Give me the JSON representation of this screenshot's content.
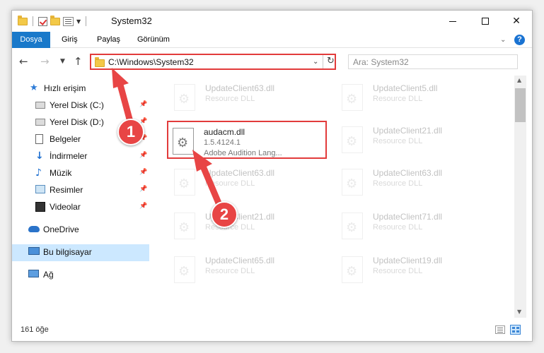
{
  "window": {
    "title": "System32"
  },
  "ribbon": {
    "tabs": [
      "Dosya",
      "Giriş",
      "Paylaş",
      "Görünüm"
    ],
    "help": "?"
  },
  "address": {
    "path": "C:\\Windows\\System32"
  },
  "search": {
    "placeholder": "Ara: System32"
  },
  "sidebar": {
    "items": [
      {
        "label": "Hızlı erişim",
        "icon": "star-icon"
      },
      {
        "label": "Yerel Disk (C:)",
        "icon": "disk-icon",
        "pinned": true
      },
      {
        "label": "Yerel Disk (D:)",
        "icon": "disk-icon",
        "pinned": true
      },
      {
        "label": "Belgeler",
        "icon": "document-icon",
        "pinned": true
      },
      {
        "label": "İndirmeler",
        "icon": "download-icon",
        "pinned": true
      },
      {
        "label": "Müzik",
        "icon": "music-icon",
        "pinned": true
      },
      {
        "label": "Resimler",
        "icon": "pictures-icon",
        "pinned": true
      },
      {
        "label": "Videolar",
        "icon": "video-icon",
        "pinned": true
      },
      {
        "label": "OneDrive",
        "icon": "cloud-icon"
      },
      {
        "label": "Bu bilgisayar",
        "icon": "computer-icon",
        "selected": true
      },
      {
        "label": "Ağ",
        "icon": "network-icon"
      }
    ]
  },
  "files": {
    "left": [
      {
        "name": "UpdateClient63.dll",
        "meta1": "Resource DLL",
        "meta2": ""
      },
      {
        "name": "audacm.dll",
        "meta1": "1.5.4124.1",
        "meta2": "Adobe Audition Lang...",
        "highlighted": true
      },
      {
        "name": "UpdateClient63.dll",
        "meta1": "Resource DLL",
        "meta2": ""
      },
      {
        "name": "UpdateClient21.dll",
        "meta1": "Resource DLL",
        "meta2": ""
      },
      {
        "name": "UpdateClient65.dll",
        "meta1": "Resource DLL",
        "meta2": ""
      }
    ],
    "right": [
      {
        "name": "UpdateClient5.dll",
        "meta1": "Resource DLL",
        "meta2": ""
      },
      {
        "name": "UpdateClient21.dll",
        "meta1": "Resource DLL",
        "meta2": ""
      },
      {
        "name": "UpdateClient63.dll",
        "meta1": "Resource DLL",
        "meta2": ""
      },
      {
        "name": "UpdateClient71.dll",
        "meta1": "Resource DLL",
        "meta2": ""
      },
      {
        "name": "UpdateClient19.dll",
        "meta1": "Resource DLL",
        "meta2": ""
      }
    ]
  },
  "status": {
    "count": "161 öğe"
  },
  "callouts": {
    "one": "1",
    "two": "2"
  },
  "colors": {
    "accent": "#1979ca",
    "highlight": "#e23b3b",
    "selected": "#cce8ff"
  }
}
